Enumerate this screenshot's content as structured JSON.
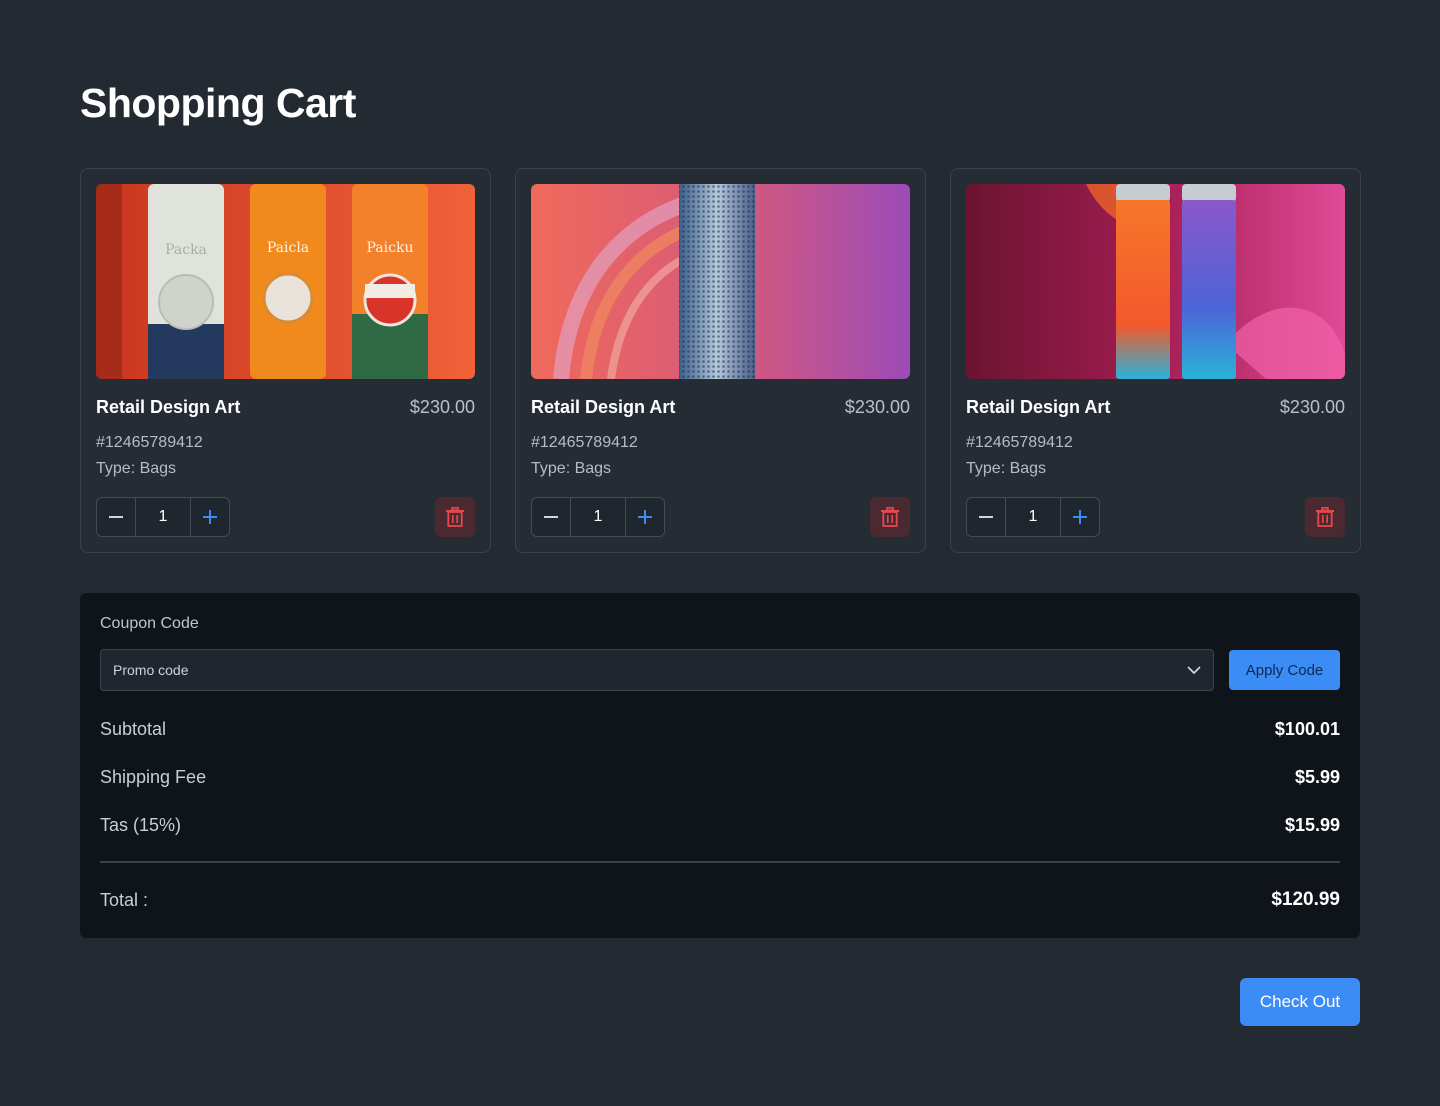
{
  "page": {
    "title": "Shopping Cart"
  },
  "cart": {
    "items": [
      {
        "title": "Retail Design Art",
        "price": "$230.00",
        "sku": "#12465789412",
        "type": "Type: Bags",
        "quantity": "1",
        "image": "orange-packaging-bottles-image",
        "image_text": [
          "Packa",
          "Paicla",
          "Paicku"
        ]
      },
      {
        "title": "Retail Design Art",
        "price": "$230.00",
        "sku": "#12465789412",
        "type": "Type: Bags",
        "quantity": "1",
        "image": "speaker-cylinder-image"
      },
      {
        "title": "Retail Design Art",
        "price": "$230.00",
        "sku": "#12465789412",
        "type": "Type: Bags",
        "quantity": "1",
        "image": "beverage-cans-image"
      }
    ],
    "icons": {
      "decrease": "minus-icon",
      "increase": "plus-icon",
      "delete": "trash-icon"
    }
  },
  "summary": {
    "coupon_label": "Coupon Code",
    "coupon_select": "Promo code",
    "apply_label": "Apply Code",
    "subtotal_label": "Subtotal",
    "subtotal_value": "$100.01",
    "shipping_label": "Shipping Fee",
    "shipping_value": "$5.99",
    "tax_label": "Tas (15%)",
    "tax_value": "$15.99",
    "total_label": "Total :",
    "total_value": "$120.99"
  },
  "checkout_label": "Check Out",
  "colors": {
    "accent": "#3b8cf5",
    "background": "#232a31",
    "panel": "#0f141b",
    "danger": "#e5484d"
  }
}
